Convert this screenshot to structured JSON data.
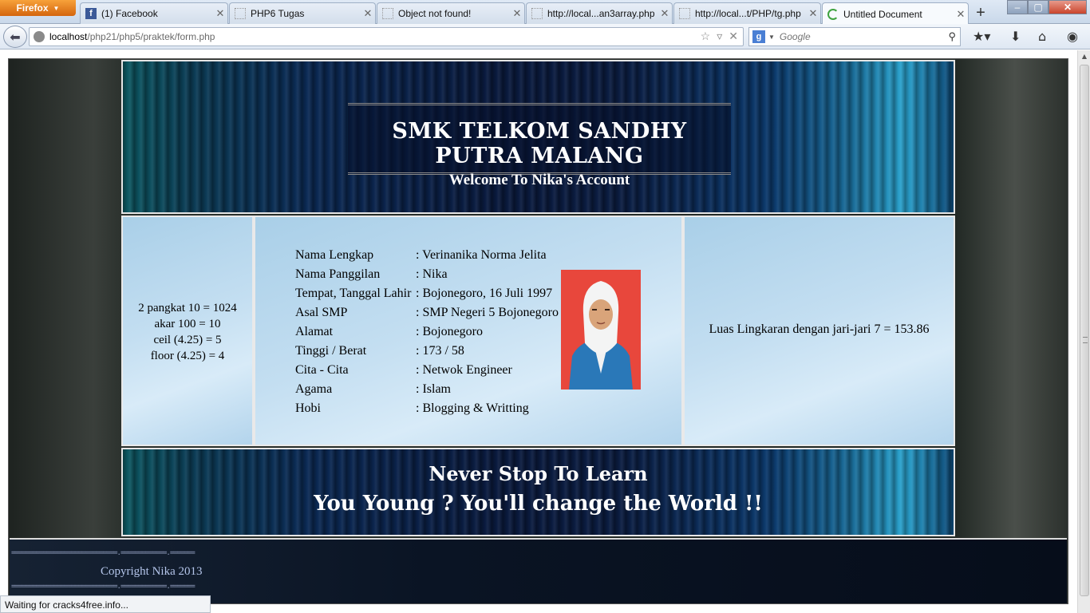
{
  "browser": {
    "menu_button": "Firefox",
    "tabs": [
      {
        "label": "(1) Facebook",
        "icon": "facebook-icon"
      },
      {
        "label": "PHP6 Tugas",
        "icon": "blank-page-icon"
      },
      {
        "label": "Object not found!",
        "icon": "blank-page-icon"
      },
      {
        "label": "http://local...an3array.php",
        "icon": "blank-page-icon"
      },
      {
        "label": "http://local...t/PHP/tg.php",
        "icon": "blank-page-icon"
      },
      {
        "label": "Untitled Document",
        "icon": "loading-icon",
        "active": true
      }
    ],
    "url_host": "localhost",
    "url_path": "/php21/php5/praktek/form.php",
    "search_placeholder": "Google",
    "status_text": "Waiting for cracks4free.info..."
  },
  "header": {
    "title": "SMK TELKOM SANDHY PUTRA MALANG",
    "subtitle": "Welcome To Nika's Account"
  },
  "math": {
    "lines": [
      "2 pangkat 10 = 1024",
      "akar 100 = 10",
      "ceil (4.25) = 5",
      "floor (4.25) = 4"
    ]
  },
  "profile": {
    "rows": [
      {
        "label": "Nama Lengkap",
        "value": ": Verinanika Norma Jelita"
      },
      {
        "label": "Nama Panggilan",
        "value": ": Nika"
      },
      {
        "label": "Tempat, Tanggal Lahir",
        "value": ": Bojonegoro, 16 Juli 1997"
      },
      {
        "label": "Asal SMP",
        "value": ": SMP Negeri 5 Bojonegoro"
      },
      {
        "label": "Alamat",
        "value": ": Bojonegoro"
      },
      {
        "label": "Tinggi / Berat",
        "value": ": 173 / 58"
      },
      {
        "label": "Cita - Cita",
        "value": ": Netwok Engineer"
      },
      {
        "label": "Agama",
        "value": ": Islam"
      },
      {
        "label": "Hobi",
        "value": ": Blogging & Writting"
      }
    ]
  },
  "circle": {
    "text": "Luas Lingkaran dengan jari-jari 7 = 153.86"
  },
  "motto": {
    "line1": "Never Stop To Learn",
    "line2": "You Young ? You'll change the World !!"
  },
  "footer": {
    "rule": "==============================.=============.=======",
    "copyright": "Copyright Nika 2013"
  },
  "colors": {
    "banner_dark": "#0a1a3e",
    "panel_blue": "#c3def1",
    "photo_bg": "#e8473c",
    "copyright_text": "#b4c5ea"
  }
}
